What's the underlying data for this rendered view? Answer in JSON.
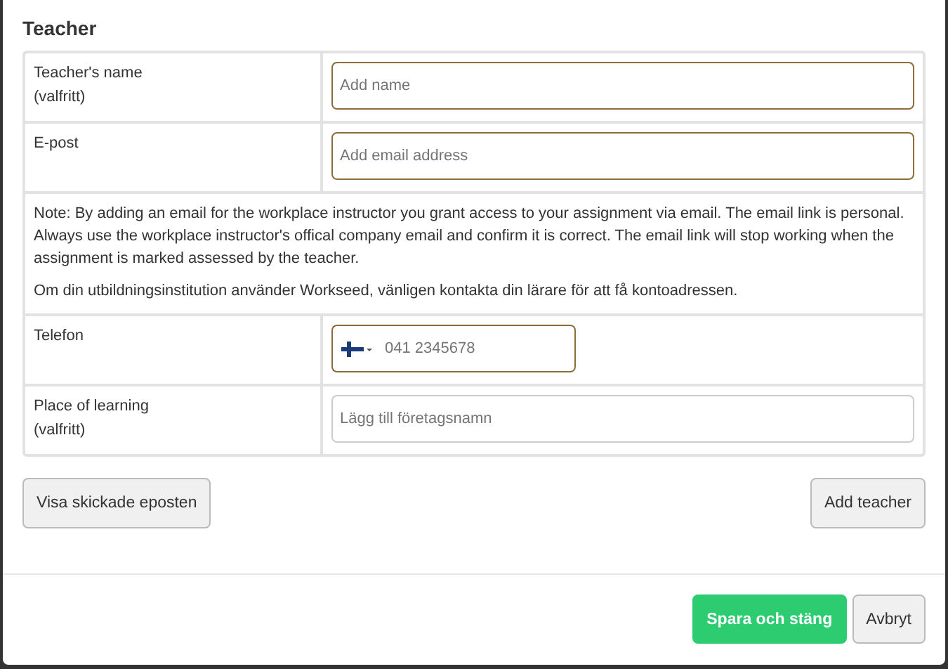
{
  "dialog": {
    "title": "Teacher"
  },
  "rows": [
    {
      "kind": "field",
      "label": "Teacher's name",
      "sublabel": "(valfritt)",
      "placeholder": "Add name",
      "highlighted": true
    },
    {
      "kind": "field",
      "label": "E-post",
      "placeholder": "Add email address",
      "highlighted": true
    },
    {
      "kind": "note",
      "paragraphs": [
        "Note: By adding an email for the workplace instructor you grant access to your assignment via email. The email link is personal. Always use the workplace instructor's offical company email and confirm it is correct. The email link will stop working when the assignment is marked assessed by the teacher.",
        "Om din utbildningsinstitution använder Workseed, vänligen kontakta din lärare för att få kontoadressen."
      ]
    },
    {
      "kind": "phone",
      "label": "Telefon",
      "placeholder": "041 2345678",
      "highlighted": true
    },
    {
      "kind": "field",
      "label": "Place of learning",
      "sublabel": "(valfritt)",
      "placeholder": "Lägg till företagsnamn",
      "highlighted": false
    }
  ],
  "actions": {
    "left": "Visa skickade eposten",
    "right": "Add teacher"
  },
  "footer": [
    {
      "label": "Spara och stäng",
      "kind": "primary"
    },
    {
      "label": "Avbryt",
      "kind": "default"
    }
  ]
}
